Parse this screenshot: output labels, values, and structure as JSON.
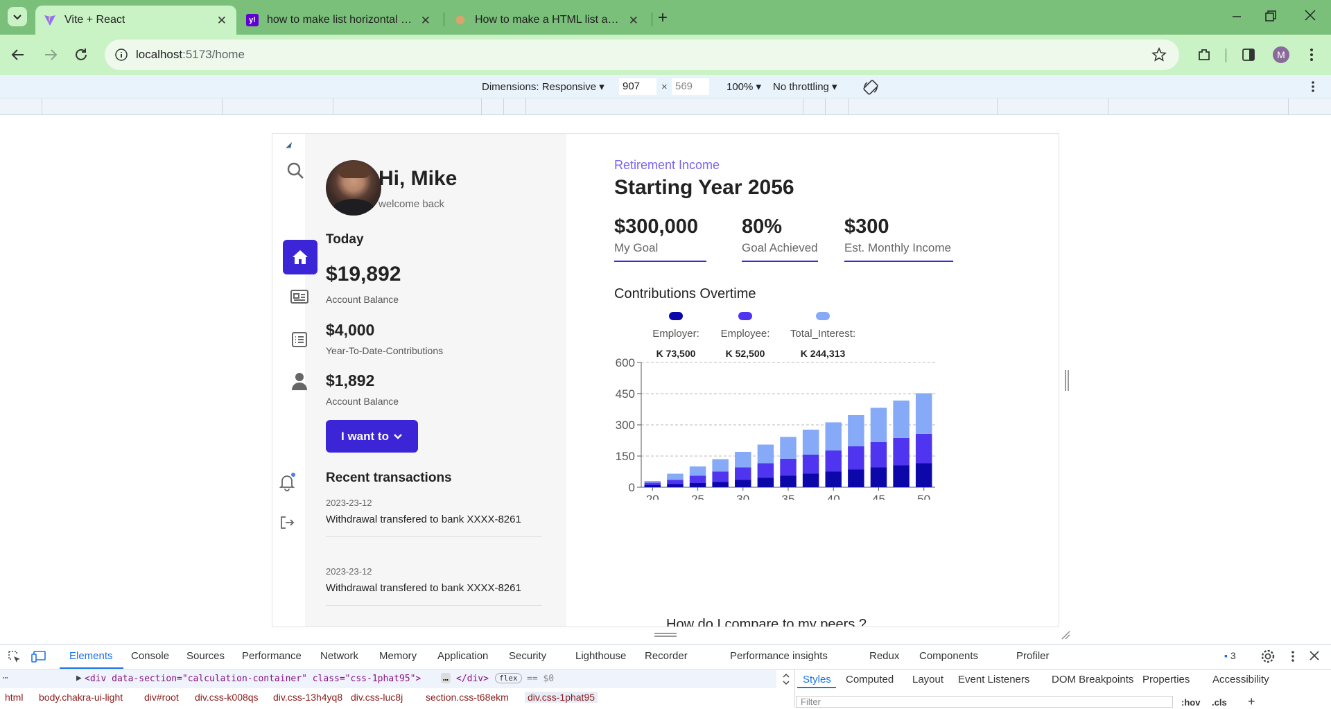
{
  "browser": {
    "tabs": [
      {
        "title": "Vite + React",
        "active": true
      },
      {
        "title": "how to make list horizontal in c",
        "active": false
      },
      {
        "title": "How to make a HTML list appea",
        "active": false
      }
    ],
    "url_host": "localhost",
    "url_path": ":5173/home",
    "profile_initial": "M"
  },
  "device_toolbar": {
    "dimensions_label": "Dimensions: Responsive",
    "width": "907",
    "times": "×",
    "height": "569",
    "zoom": "100%",
    "throttle": "No throttling"
  },
  "user": {
    "greeting": "Hi, Mike",
    "subtitle": "welcome back"
  },
  "summary": {
    "today_label": "Today",
    "stats": [
      {
        "value": "$19,892",
        "label": "Account Balance"
      },
      {
        "value": "$4,000",
        "label": "Year-To-Date-Contributions"
      },
      {
        "value": "$1,892",
        "label": "Account Balance"
      }
    ],
    "action_button": "I want to"
  },
  "transactions": {
    "title": "Recent transactions",
    "items": [
      {
        "date": "2023-23-12",
        "desc": "Withdrawal transfered to bank XXXX-8261"
      },
      {
        "date": "2023-23-12",
        "desc": "Withdrawal transfered to bank XXXX-8261"
      }
    ]
  },
  "retirement": {
    "eyebrow": "Retirement Income",
    "title": "Starting Year 2056",
    "metrics": [
      {
        "value": "$300,000",
        "label": "My Goal"
      },
      {
        "value": "80%",
        "label": "Goal Achieved"
      },
      {
        "value": "$300",
        "label": "Est. Monthly Income"
      }
    ],
    "chart_title": "Contributions Overtime",
    "peers_title": "How do I compare to my peers ?"
  },
  "chart_data": {
    "type": "bar",
    "stacked": true,
    "legend_position": "top",
    "grid": "horizontal-dashed",
    "categories": [
      "20",
      "22",
      "25",
      "27",
      "30",
      "32",
      "35",
      "37",
      "40",
      "42",
      "45",
      "47",
      "50"
    ],
    "xticks": [
      "20",
      "25",
      "30",
      "35",
      "40",
      "45",
      "50"
    ],
    "ylim": [
      0,
      600
    ],
    "yticks": [
      "0",
      "150",
      "300",
      "450",
      "600"
    ],
    "series": [
      {
        "name": "Employer:",
        "total_label": "K 73,500",
        "color": "#0b07a8",
        "values": [
          10,
          15,
          20,
          25,
          35,
          45,
          55,
          65,
          75,
          85,
          95,
          105,
          115
        ]
      },
      {
        "name": "Employee:",
        "total_label": "K 52,500",
        "color": "#4f35f0",
        "values": [
          12,
          20,
          35,
          50,
          60,
          70,
          82,
          92,
          102,
          112,
          122,
          132,
          142
        ]
      },
      {
        "name": "Total_Interest:",
        "total_label": "K 244,313",
        "color": "#86aaf7",
        "values": [
          8,
          30,
          45,
          60,
          75,
          90,
          105,
          120,
          135,
          150,
          165,
          180,
          195
        ]
      }
    ]
  },
  "devtools": {
    "tabs": [
      "Elements",
      "Console",
      "Sources",
      "Performance",
      "Network",
      "Memory",
      "Application",
      "Security",
      "Lighthouse",
      "Recorder",
      "Performance insights",
      "Redux",
      "Components",
      "Profiler"
    ],
    "issues_count": "3",
    "dom_line": "<div data-section=\"calculation-container\" class=\"css-1phat95\">",
    "dom_tail": "</div>",
    "dom_flex_badge": "flex",
    "dom_eq": "== $0",
    "breadcrumbs": [
      "html",
      "body.chakra-ui-light",
      "div#root",
      "div.css-k008qs",
      "div.css-13h4yq8",
      "div.css-luc8j",
      "section.css-t68ekm",
      "div.css-1phat95"
    ],
    "side_tabs": [
      "Styles",
      "Computed",
      "Layout",
      "Event Listeners",
      "DOM Breakpoints",
      "Properties",
      "Accessibility"
    ],
    "filter_placeholder": "Filter",
    "hov": ":hov",
    "cls": ".cls"
  },
  "colors": {
    "accent": "#3b25d6",
    "tabstrip": "#7abf7a",
    "toolbar": "#c9f2c5",
    "eyebrow": "#7c63f2"
  }
}
